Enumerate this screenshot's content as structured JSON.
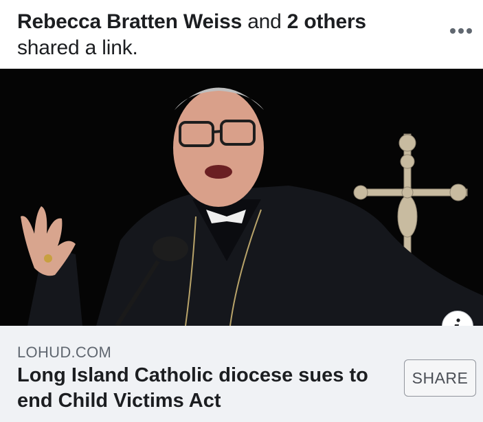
{
  "post_header": {
    "author": "Rebecca Bratten Weiss",
    "connector": " and ",
    "others": "2 others",
    "action": "shared a link."
  },
  "icons": {
    "more": "more-options-icon",
    "info": "info-icon"
  },
  "link_preview": {
    "domain": "LOHUD.COM",
    "headline": "Long Island Catholic diocese sues to end Child Victims Act",
    "share_label": "SHARE"
  },
  "colors": {
    "text_primary": "#1c1e21",
    "text_secondary": "#606770",
    "link_background": "#f0f2f5",
    "photo_background": "#050505"
  }
}
